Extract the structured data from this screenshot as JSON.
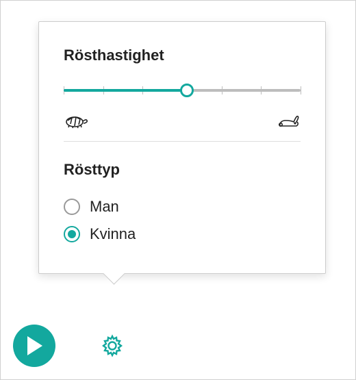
{
  "speed": {
    "title": "Rösthastighet",
    "value_percent": 52,
    "ticks_count": 7,
    "slow_icon": "turtle",
    "fast_icon": "rabbit"
  },
  "voice": {
    "title": "Rösttyp",
    "options": [
      {
        "label": "Man",
        "selected": false
      },
      {
        "label": "Kvinna",
        "selected": true
      }
    ]
  },
  "colors": {
    "accent": "#13a89e"
  }
}
